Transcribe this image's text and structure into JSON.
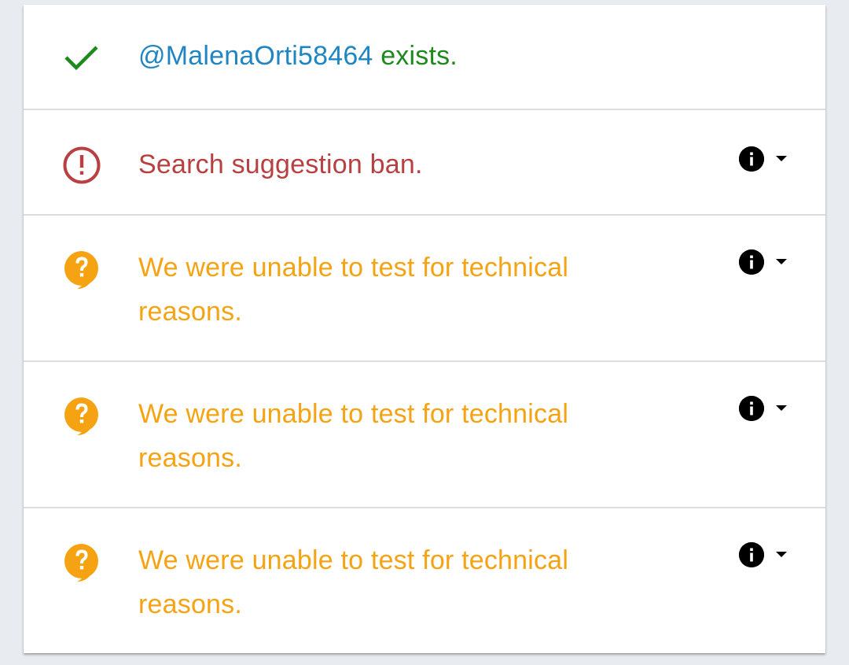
{
  "colors": {
    "handle": "#1f86c3",
    "success": "#1e8a1e",
    "error": "#b94040",
    "warning": "#f5a312",
    "page_background": "#e8ecf0"
  },
  "rows": [
    {
      "status": "success",
      "icon": "check-icon",
      "handle": "@MalenaOrti58464",
      "text": "exists."
    },
    {
      "status": "error",
      "icon": "exclamation-circle-icon",
      "text": "Search suggestion ban.",
      "actions": [
        "info-icon",
        "caret-down-icon"
      ]
    },
    {
      "status": "warning",
      "icon": "question-bubble-icon",
      "text": "We were unable to test for technical reasons.",
      "actions": [
        "info-icon",
        "caret-down-icon"
      ]
    },
    {
      "status": "warning",
      "icon": "question-bubble-icon",
      "text": "We were unable to test for technical reasons.",
      "actions": [
        "info-icon",
        "caret-down-icon"
      ]
    },
    {
      "status": "warning",
      "icon": "question-bubble-icon",
      "text": "We were unable to test for technical reasons.",
      "actions": [
        "info-icon",
        "caret-down-icon"
      ]
    }
  ]
}
